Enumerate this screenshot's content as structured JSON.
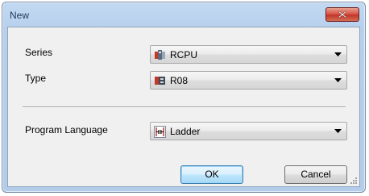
{
  "dialog": {
    "title": "New",
    "series": {
      "label": "Series",
      "value": "RCPU"
    },
    "type": {
      "label": "Type",
      "value": "R08"
    },
    "language": {
      "label": "Program Language",
      "value": "Ladder"
    },
    "ok_label": "OK",
    "cancel_label": "Cancel"
  },
  "colors": {
    "titlebar": "#b9d1ea",
    "close_button": "#c7433a",
    "client_background": "#f0f0f0",
    "default_button_border": "#3c7fb1"
  }
}
